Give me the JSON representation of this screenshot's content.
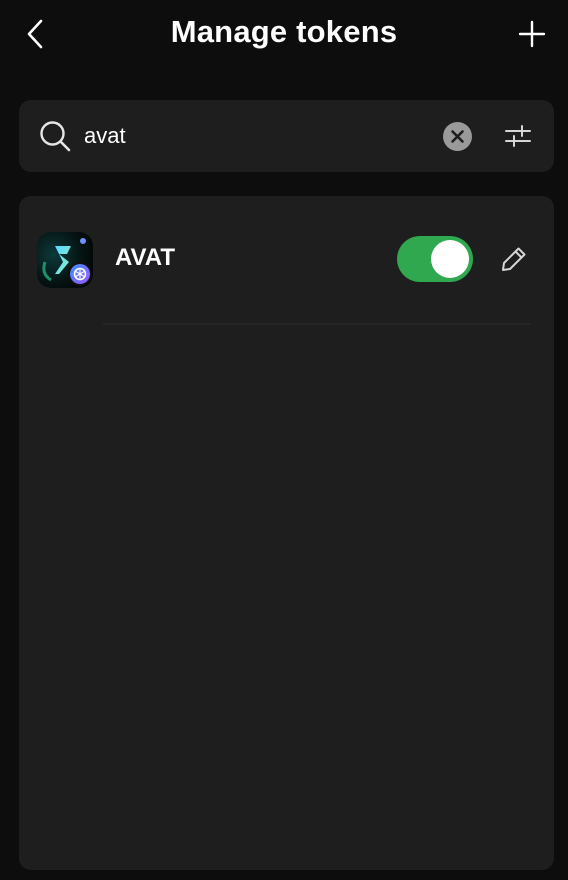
{
  "header": {
    "title": "Manage tokens",
    "back_icon": "chevron-left-icon",
    "add_icon": "plus-icon"
  },
  "search": {
    "value": "avat",
    "placeholder": "",
    "search_icon": "search-icon",
    "clear_icon": "clear-icon",
    "filter_icon": "sliders-icon"
  },
  "tokens": [
    {
      "symbol": "AVAT",
      "enabled": true,
      "logo_icon": "avat-token-logo",
      "network_badge_icon": "network-badge-icon",
      "edit_icon": "pencil-icon"
    }
  ],
  "colors": {
    "background": "#0d0d0d",
    "panel": "#1e1e1e",
    "toggle_on": "#2fa84f",
    "clear_button": "#9a9a9a"
  }
}
